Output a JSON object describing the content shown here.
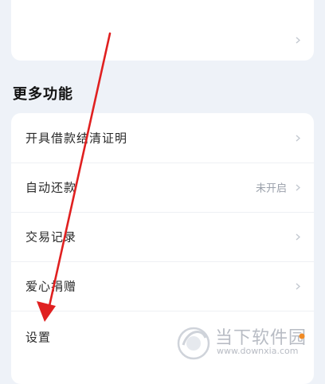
{
  "colors": {
    "background": "#eef2f8",
    "card": "#ffffff",
    "chevron": "#c3c8d0",
    "status_text": "#9aa0aa",
    "annotation_arrow": "#e02020",
    "watermark_dot": "#f08a24"
  },
  "top_card": {
    "chevron_icon": "chevron-right-icon"
  },
  "more_features": {
    "title": "更多功能",
    "items": [
      {
        "label": "开具借款结清证明",
        "status": "",
        "icon": "chevron-right-icon"
      },
      {
        "label": "自动还款",
        "status": "未开启",
        "icon": "chevron-right-icon"
      },
      {
        "label": "交易记录",
        "status": "",
        "icon": "chevron-right-icon"
      },
      {
        "label": "爱心捐赠",
        "status": "",
        "icon": "chevron-right-icon"
      },
      {
        "label": "设置",
        "status": "",
        "icon": ""
      }
    ]
  },
  "watermark": {
    "logo_icon": "downxia-logo-icon",
    "name": "当下软件园",
    "url": "www.downxia.com"
  }
}
